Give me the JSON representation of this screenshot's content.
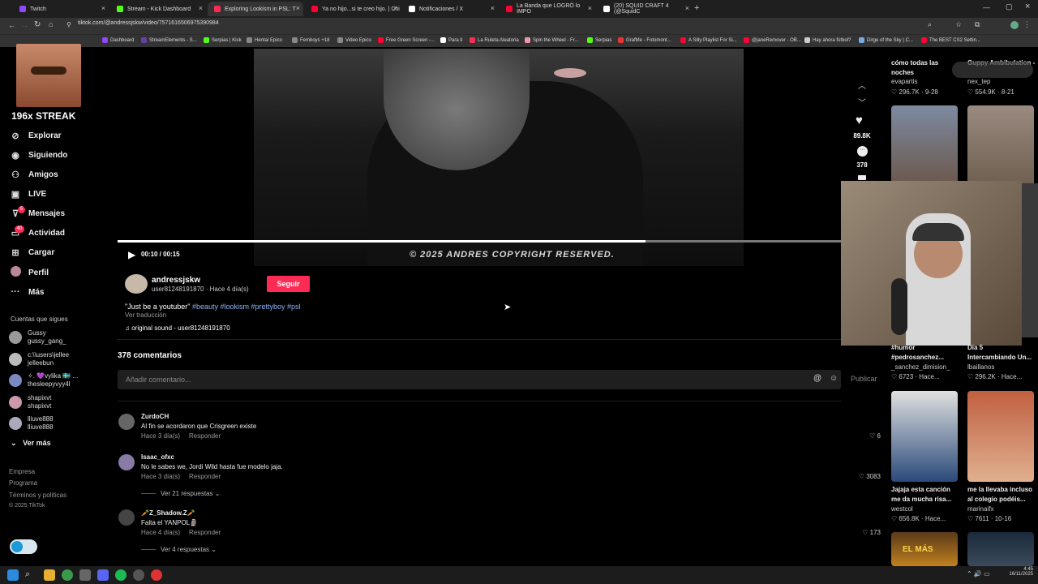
{
  "browser": {
    "tabs": [
      {
        "label": "Twitch",
        "color": "#9146ff"
      },
      {
        "label": "Stream - Kick Dashboard",
        "color": "#53fc18"
      },
      {
        "label": "Exploring Lookism in PSL: T",
        "color": "#fe2c55"
      },
      {
        "label": "Ya no hijo...si te creo hijo. | Chi",
        "color": "#ff0033"
      },
      {
        "label": "Notificaciones / X",
        "color": "#ffffff"
      },
      {
        "label": "La Banda que LOGRÓ lo IMPO",
        "color": "#ff0033"
      },
      {
        "label": "(20) SQUID CRAFT 4 (@SquidC",
        "color": "#ffffff"
      }
    ],
    "url": "tiktok.com/@andressjskw/video/7571616506975390984",
    "bookmarks": [
      "Dashboard",
      "StreamElements - S...",
      "Serpias | Kick",
      "Hentai Epico",
      "Femboys +18",
      "Video Epico",
      "Free Green Screen -...",
      "Para ti",
      "La Ruleta Aleatoria",
      "Spin the Wheel - Fr...",
      "Serpias",
      "GrafMe - Fotomont...",
      "A Silly Playlist For Si...",
      "@janeRemover - OB...",
      "Hay ahora fútbol?",
      "Dirge of the Sky | C...",
      "The BEST CS2 Settin..."
    ]
  },
  "overlay": {
    "streak": "196x STREAK"
  },
  "sidebar": {
    "nav": [
      {
        "label": "Explorar",
        "icon": "compass-icon"
      },
      {
        "label": "Siguiendo",
        "icon": "following-icon"
      },
      {
        "label": "Amigos",
        "icon": "friends-icon"
      },
      {
        "label": "LIVE",
        "icon": "live-icon"
      },
      {
        "label": "Mensajes",
        "icon": "messages-icon"
      },
      {
        "label": "Actividad",
        "icon": "activity-icon"
      },
      {
        "label": "Cargar",
        "icon": "upload-icon"
      },
      {
        "label": "Perfil",
        "icon": "profile-icon"
      },
      {
        "label": "Más",
        "icon": "more-icon"
      }
    ],
    "badges": {
      "mensajes": "5",
      "actividad": "40"
    },
    "following_title": "Cuentas que sigues",
    "following": [
      {
        "name": "Gussy",
        "handle": "gussy_gang_"
      },
      {
        "name": "c:\\\\users\\jellee",
        "handle": "jelleebun"
      },
      {
        "name": "✧. 💜vylika 🇸🇪 ...",
        "handle": "thesleepyvyy4l"
      },
      {
        "name": "shapixvt",
        "handle": "shapixvt"
      },
      {
        "name": "lliuve888",
        "handle": "lliuve888"
      }
    ],
    "see_more": "Ver más",
    "footer": [
      "Empresa",
      "Programa",
      "Términos y políticas",
      "© 2025 TikTok"
    ]
  },
  "video": {
    "time": "00:10 / 00:15",
    "watermark": "© 2025 ANDRES COPYRIGHT RESERVED.",
    "progress": 0.73
  },
  "actions": {
    "likes": "89.8K",
    "comments": "378"
  },
  "post": {
    "username": "andressjskw",
    "meta": "user81248191870 · Hace 4 día(s)",
    "follow_button": "Seguir",
    "caption": "\"Just be a youtuber\"",
    "hashtags": "#beauty #lookism #prettyboy #psl",
    "translate": "Ver traducción",
    "sound": "♫ original sound - user81248191870"
  },
  "comments_section": {
    "count_label": "378 comentarios",
    "input_placeholder": "Añadir comentario...",
    "publish": "Publicar",
    "items": [
      {
        "user": "ZurdoCH",
        "text": "Al fin se acordaron que Crisgreen existe",
        "time": "Hace 3 día(s)",
        "reply": "Responder",
        "likes": "6",
        "replies": ""
      },
      {
        "user": "Isaac_ofxc",
        "text": "No le sabes we, Jordi Wild hasta fue modelo jaja.",
        "time": "Hace 3 día(s)",
        "reply": "Responder",
        "likes": "3083",
        "replies": "Ver 21 respuestas"
      },
      {
        "user": "🥕Z_Shadow.Z🥕",
        "text": "Falta el YANPOL🗿",
        "time": "Hace 4 día(s)",
        "reply": "Responder",
        "likes": "173",
        "replies": "Ver 4 respuestas"
      }
    ]
  },
  "grid": [
    {
      "caption": "cómo todas las",
      "caption2": "noches",
      "author": "evapartis",
      "stats": "♡ 296.7K · 9-28",
      "color": "#7a6a5a"
    },
    {
      "caption": "Guppy Ambibulation -",
      "caption2": "",
      "author": "nex_tep",
      "stats": "♡ 554.9K · 8-21",
      "color": "#6a5a4a"
    },
    {
      "caption": "#humor",
      "caption2": "#pedrosanchez...",
      "author": "_sanchez_dimision_",
      "stats": "♡ 6723 · Hace...",
      "color": "#b08a78"
    },
    {
      "caption": "Día 5",
      "caption2": "Intercambiando Un...",
      "author": "lbaillanos",
      "stats": "♡ 296.2K · Hace...",
      "color": "#8a6a58"
    },
    {
      "caption": "Jajaja esta canción",
      "caption2": "me da mucha risa...",
      "author": "westcol",
      "stats": "♡ 656.8K · Hace...",
      "color": "#c8c8c8"
    },
    {
      "caption": "me la llevaba incluso",
      "caption2": "al colegio podéis...",
      "author": "marinaifx",
      "stats": "♡ 7611 · 10-16",
      "color": "#d08060"
    },
    {
      "caption": "",
      "caption2": "",
      "author": "",
      "stats": "",
      "color": "#4a2a10"
    },
    {
      "caption": "",
      "caption2": "",
      "author": "",
      "stats": "",
      "color": "#1a2a3a"
    }
  ],
  "grid_overlay_text": "EL MÁS",
  "taskbar": {
    "time": "4:45",
    "date": "16/11/2025"
  }
}
